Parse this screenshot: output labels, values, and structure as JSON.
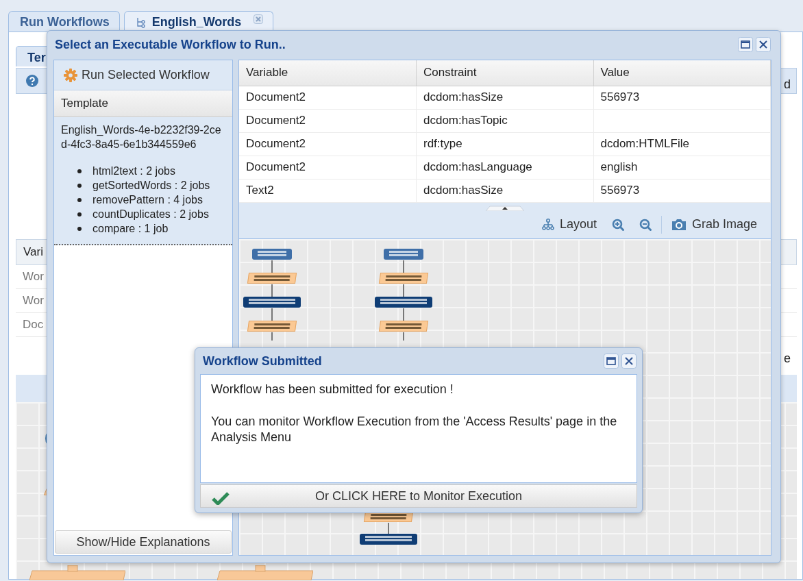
{
  "app_tabs": [
    {
      "label": "Run Workflows",
      "selected": false,
      "kind": "plain",
      "closable": false
    },
    {
      "label": "English_Words",
      "selected": true,
      "kind": "workflow",
      "closable": true
    }
  ],
  "background": {
    "inner_tab": "Ter",
    "table_header": "Vari",
    "rows": [
      "Wor",
      "Wor",
      "Doc"
    ],
    "right_texts": [
      "d",
      "e"
    ]
  },
  "dialog": {
    "title": "Select an Executable Workflow to Run..",
    "run_button": "Run Selected Workflow",
    "template_header": "Template",
    "template_name": "English_Words-4e-b2232f39-2ced-4fc3-8a45-6e1b344559e6",
    "jobs": [
      "html2text : 2 jobs",
      "getSortedWords : 2 jobs",
      "removePattern : 4 jobs",
      "countDuplicates : 2 jobs",
      "compare : 1 job"
    ],
    "explain_button": "Show/Hide Explanations",
    "table": {
      "columns": [
        "Variable",
        "Constraint",
        "Value"
      ],
      "rows": [
        {
          "variable": "Document2",
          "constraint": "dcdom:hasSize",
          "value": "556973"
        },
        {
          "variable": "Document2",
          "constraint": "dcdom:hasTopic"
        },
        {
          "variable": "Document2",
          "constraint": "rdf:type",
          "value": "dcdom:HTMLFile"
        },
        {
          "variable": "Document2",
          "constraint": "dcdom:hasLanguage",
          "value": "english"
        },
        {
          "variable": "Text2",
          "constraint": "dcdom:hasSize",
          "value": "556973"
        }
      ]
    },
    "toolbar": [
      {
        "kind": "layout",
        "label": "Layout"
      },
      {
        "kind": "zoom_in"
      },
      {
        "kind": "zoom_out"
      },
      {
        "kind": "camera",
        "label": "Grab Image"
      }
    ],
    "graph": {
      "columns": [
        [
          {
            "kind": "data"
          },
          {
            "kind": "process"
          },
          {
            "kind": "variable"
          },
          {
            "kind": "process"
          }
        ],
        [
          {
            "kind": "data"
          },
          {
            "kind": "process"
          },
          {
            "kind": "variable"
          },
          {
            "kind": "process"
          }
        ]
      ],
      "final": [
        {
          "kind": "process"
        },
        {
          "kind": "variable"
        }
      ]
    }
  },
  "popup": {
    "title": "Workflow Submitted",
    "messages": [
      "Workflow has been submitted for execution !",
      "You can monitor Workflow Execution from the 'Access Results' page in the Analysis Menu"
    ],
    "button": "Or CLICK HERE to Monitor Execution"
  }
}
